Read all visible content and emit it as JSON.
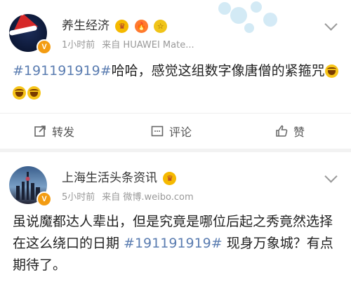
{
  "post1": {
    "name": "养生经济",
    "meta": {
      "time": "1小时前",
      "source": "来自 HUAWEI Mate..."
    },
    "text": {
      "hashtag": "#191191919#",
      "content": "哈哈，感觉这组数字像唐僧的紧箍咒"
    },
    "badges": [
      "crown",
      "flame",
      "gold"
    ],
    "actions": {
      "repost": "转发",
      "comment": "评论",
      "like": "赞"
    }
  },
  "post2": {
    "name": "上海生活头条资讯",
    "meta": {
      "time": "5小时前",
      "source": "来自 微博.weibo.com"
    },
    "text": {
      "before": "虽说魔都达人辈出，但是究竟是哪位后起之秀竟然选择在这么绕口的日期 ",
      "hashtag": "#191191919#",
      "after": " 现身万象城？有点期待了。"
    },
    "badges": [
      "crown"
    ]
  },
  "colors": {
    "link": "#5b7db1",
    "badge": "#f39c12"
  }
}
